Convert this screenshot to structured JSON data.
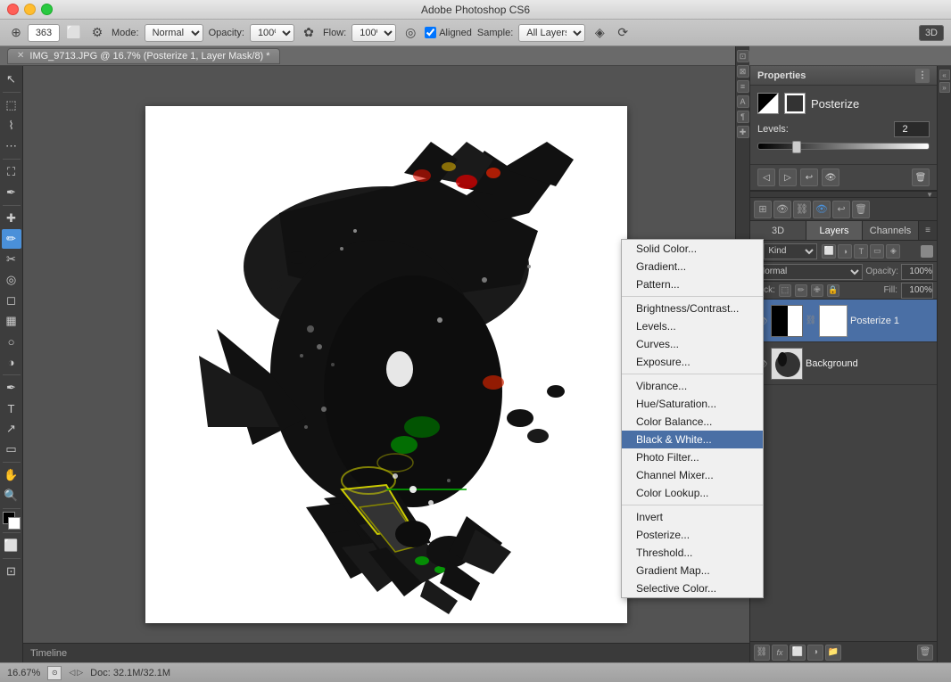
{
  "window": {
    "title": "Adobe Photoshop CS6",
    "doc_title": "IMG_9713.JPG @ 16.7% (Posterize 1, Layer Mask/8) *"
  },
  "toolbar": {
    "mode_label": "Mode:",
    "mode_value": "Normal",
    "opacity_label": "Opacity:",
    "opacity_value": "100%",
    "flow_label": "Flow:",
    "flow_value": "100%",
    "aligned_label": "Aligned",
    "sample_label": "Sample:",
    "sample_value": "All Layers",
    "brush_size": "363",
    "three_d": "3D"
  },
  "properties": {
    "title": "Properties",
    "adj_name": "Posterize",
    "levels_label": "Levels:",
    "levels_value": "2",
    "icons": [
      "◁",
      "▷",
      "⊕",
      "⊗"
    ]
  },
  "layers": {
    "tabs": [
      "3D",
      "Layers",
      "Channels"
    ],
    "filter_label": "Kind",
    "blend_label": "Normal",
    "opacity_label": "Opacity:",
    "opacity_value": "100%",
    "fill_label": "Fill:",
    "fill_value": "100%",
    "lock_label": "Lock:",
    "items": [
      {
        "name": "Posterize 1",
        "type": "adjustment",
        "visible": true,
        "selected": true,
        "has_mask": true
      },
      {
        "name": "Background",
        "type": "raster",
        "visible": true,
        "selected": false,
        "has_mask": false
      }
    ]
  },
  "context_menu": {
    "items": [
      {
        "label": "Solid Color...",
        "disabled": false,
        "highlighted": false,
        "sep_before": false
      },
      {
        "label": "Gradient...",
        "disabled": false,
        "highlighted": false,
        "sep_before": false
      },
      {
        "label": "Pattern...",
        "disabled": false,
        "highlighted": false,
        "sep_before": false
      },
      {
        "label": "",
        "sep": true
      },
      {
        "label": "Brightness/Contrast...",
        "disabled": false,
        "highlighted": false,
        "sep_before": false
      },
      {
        "label": "Levels...",
        "disabled": false,
        "highlighted": false,
        "sep_before": false
      },
      {
        "label": "Curves...",
        "disabled": false,
        "highlighted": false,
        "sep_before": false
      },
      {
        "label": "Exposure...",
        "disabled": false,
        "highlighted": false,
        "sep_before": false
      },
      {
        "label": "",
        "sep": true
      },
      {
        "label": "Vibrance...",
        "disabled": false,
        "highlighted": false,
        "sep_before": false
      },
      {
        "label": "Hue/Saturation...",
        "disabled": false,
        "highlighted": false,
        "sep_before": false
      },
      {
        "label": "Color Balance...",
        "disabled": false,
        "highlighted": false,
        "sep_before": false
      },
      {
        "label": "Black & White...",
        "disabled": false,
        "highlighted": true,
        "sep_before": false
      },
      {
        "label": "Photo Filter...",
        "disabled": false,
        "highlighted": false,
        "sep_before": false
      },
      {
        "label": "Channel Mixer...",
        "disabled": false,
        "highlighted": false,
        "sep_before": false
      },
      {
        "label": "Color Lookup...",
        "disabled": false,
        "highlighted": false,
        "sep_before": false
      },
      {
        "label": "",
        "sep": true
      },
      {
        "label": "Invert",
        "disabled": false,
        "highlighted": false,
        "sep_before": false
      },
      {
        "label": "Posterize...",
        "disabled": false,
        "highlighted": false,
        "sep_before": false
      },
      {
        "label": "Threshold...",
        "disabled": false,
        "highlighted": false,
        "sep_before": false
      },
      {
        "label": "Gradient Map...",
        "disabled": false,
        "highlighted": false,
        "sep_before": false
      },
      {
        "label": "Selective Color...",
        "disabled": false,
        "highlighted": false,
        "sep_before": false
      }
    ]
  },
  "status": {
    "zoom": "16.67%",
    "doc_info": "Doc: 32.1M/32.1M"
  },
  "timeline": {
    "label": "Timeline"
  }
}
